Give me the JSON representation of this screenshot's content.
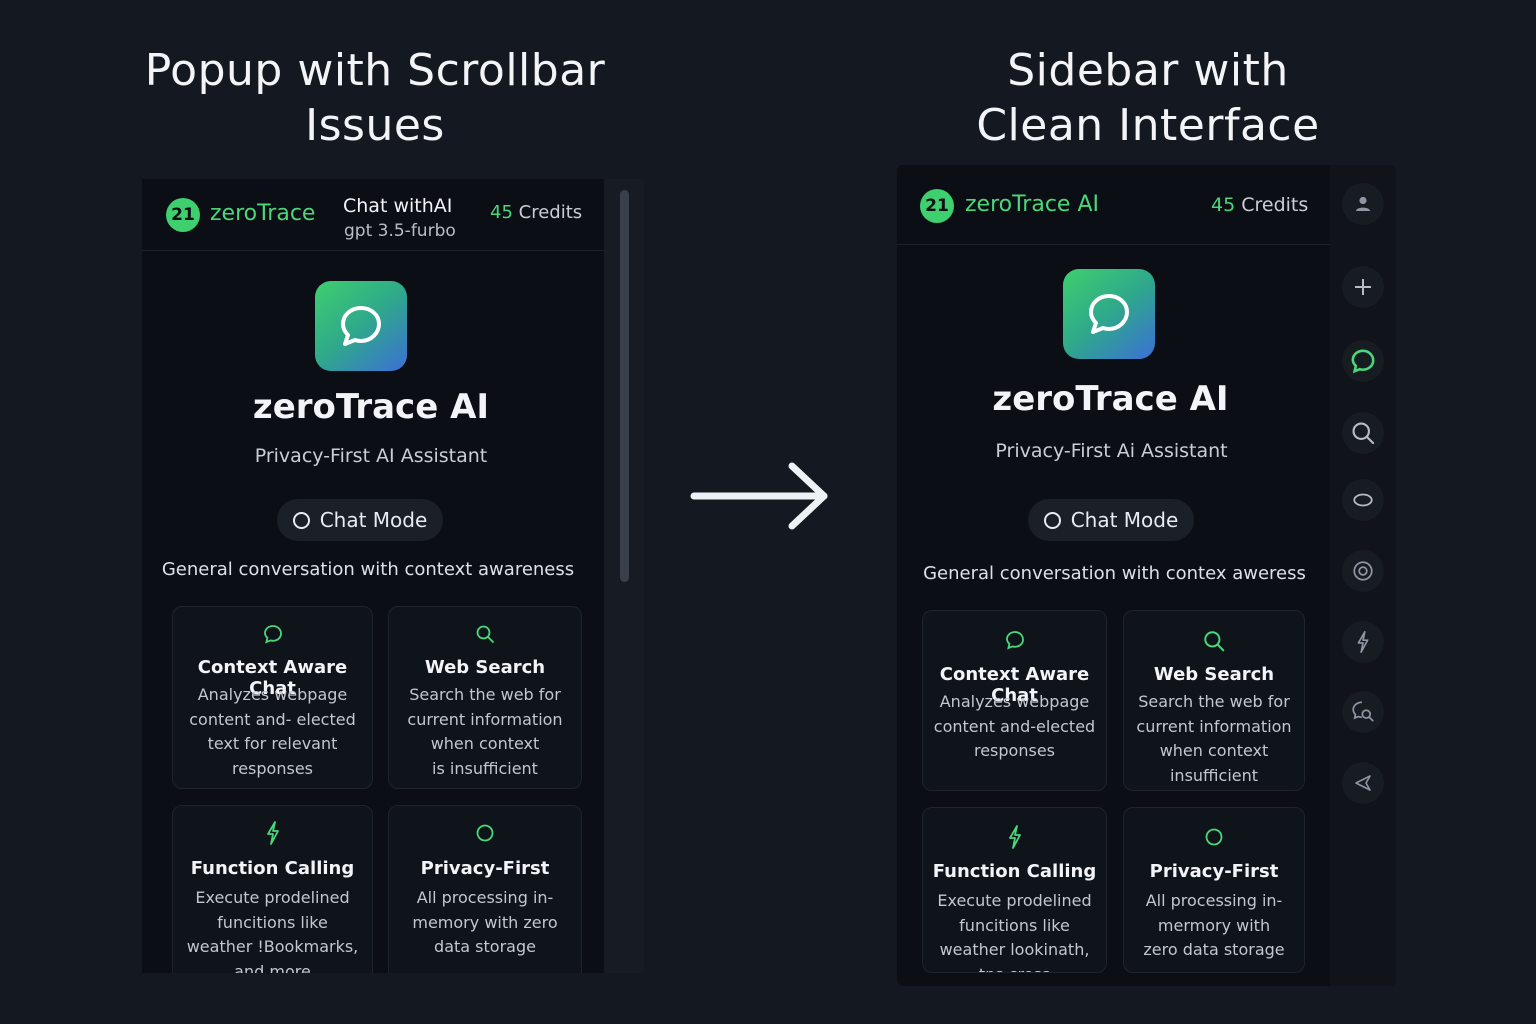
{
  "left_heading": {
    "line1": "Popup with Scrollbar",
    "line2": "Issues"
  },
  "right_heading": {
    "line1": "Sidebar with",
    "line2": "Clean Interface"
  },
  "popup": {
    "badge": "21",
    "brand": "zeroTrace",
    "chat_title": "Chat withAI",
    "model": "gpt 3.5-furbo",
    "credits_num": "45",
    "credits_label": "Credits",
    "app_name": "zeroTrace AI",
    "tagline": "Privacy-First AI Assistant",
    "mode": "Chat Mode",
    "mode_desc": "General conversation with context awareness",
    "cards": [
      {
        "icon": "chat-bubble-icon",
        "title": "Context Aware Chat",
        "desc": [
          "Analyzes webpage",
          "content and- elected",
          "text for relevant",
          "responses"
        ]
      },
      {
        "icon": "search-icon",
        "title": "Web Search",
        "desc": [
          "Search the web for",
          "current information",
          "when context",
          "is insufficient"
        ]
      },
      {
        "icon": "lightning-icon",
        "title": "Function Calling",
        "desc": [
          "Execute prodelined",
          "funcitions like",
          "weather !Bookmarks,",
          "and more"
        ]
      },
      {
        "icon": "circle-icon",
        "title": "Privacy-First",
        "desc": [
          "All processing in-",
          "memory with zero",
          "data storage"
        ]
      }
    ]
  },
  "sidebar": {
    "badge": "21",
    "brand": "zeroTrace AI",
    "credits_num": "45",
    "credits_label": "Credits",
    "app_name": "zeroTrace AI",
    "tagline": "Privacy-First Ai Assistant",
    "mode": "Chat Mode",
    "mode_desc": "General conversation with contex aweress",
    "cards": [
      {
        "icon": "chat-bubble-icon",
        "title": "Context Aware Chat",
        "desc": [
          "Analyzes webpage",
          "content and-elected",
          "responses"
        ]
      },
      {
        "icon": "search-icon",
        "title": "Web Search",
        "desc": [
          "Search the web for",
          "current information",
          "when context",
          "insufficient"
        ]
      },
      {
        "icon": "lightning-icon",
        "title": "Function Calling",
        "desc": [
          "Execute prodelined",
          "funcitions like",
          "weather lookinath,",
          "tps cross"
        ]
      },
      {
        "icon": "circle-icon",
        "title": "Privacy-First",
        "desc": [
          "All processing in-",
          "mermory with",
          "zero data storage"
        ]
      }
    ],
    "rail": [
      "user-icon",
      "plus-icon",
      "chat-bubble-icon",
      "search-icon",
      "eye-icon",
      "target-icon",
      "lightning-icon",
      "search-chat-icon",
      "send-icon"
    ]
  },
  "colors": {
    "accent": "#4ad77a",
    "background": "#141821",
    "panel": "#0b0e14"
  }
}
